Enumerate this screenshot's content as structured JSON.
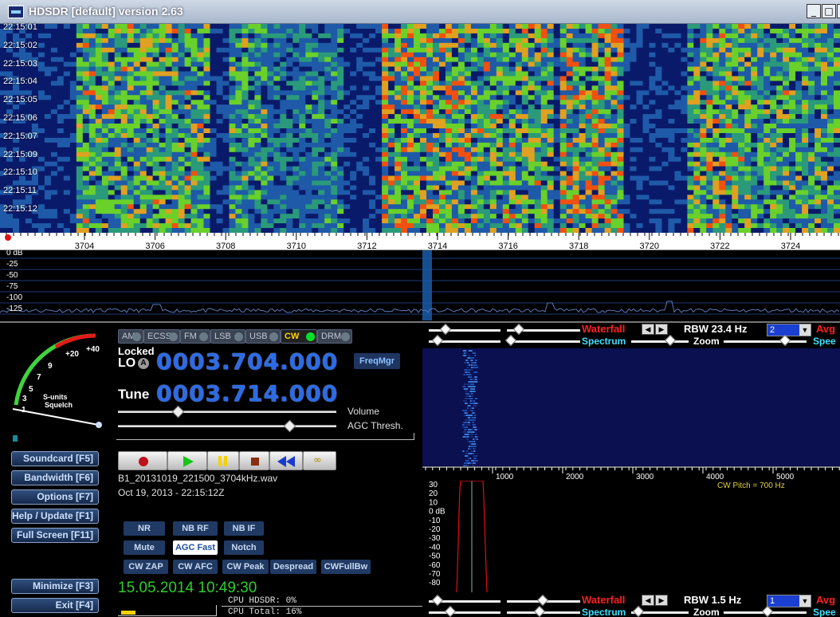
{
  "window": {
    "title": "HDSDR [default]  version 2.63",
    "minimize_glyph": "_",
    "maximize_glyph": "□",
    "close_glyph": "x"
  },
  "waterfall": {
    "timestamps": [
      "22:15:01",
      "22:15:02",
      "22:15:03",
      "22:15:04",
      "22:15:05",
      "22:15:06",
      "22:15:07",
      "22:15:09",
      "22:15:10",
      "22:15:11",
      "22:15:12"
    ]
  },
  "freq_scale": {
    "labels": [
      "3704",
      "3706",
      "3708",
      "3710",
      "3712",
      "3714",
      "3716",
      "3718",
      "3720",
      "3722",
      "3724"
    ]
  },
  "spectrum": {
    "db_labels": [
      "0 dB",
      "-25",
      "-50",
      "-75",
      "-100",
      "-125"
    ]
  },
  "smeter": {
    "scale_labels": [
      "1",
      "3",
      "5",
      "7",
      "9",
      "+20",
      "+40"
    ],
    "label1": "S-units",
    "label2": "Squelch"
  },
  "modes": [
    {
      "label": "AM",
      "active": false
    },
    {
      "label": "ECSS",
      "active": false
    },
    {
      "label": "FM",
      "active": false
    },
    {
      "label": "LSB",
      "active": false
    },
    {
      "label": "USB",
      "active": false
    },
    {
      "label": "CW",
      "active": true
    },
    {
      "label": "DRM",
      "active": false
    }
  ],
  "lo": {
    "locked_label": "Locked",
    "label": "LO",
    "badge": "A",
    "frequency": "0003.704.000"
  },
  "tune": {
    "label": "Tune",
    "frequency": "0003.714.000"
  },
  "freqmgr_label": "FreqMgr",
  "volume_label": "Volume",
  "agc_thresh_label": "AGC Thresh.",
  "side_buttons": [
    "Soundcard [F5]",
    "Bandwidth [F6]",
    "Options  [F7]",
    "Help / Update [F1]",
    "Full Screen [F11]",
    "Minimize [F3]",
    "Exit    [F4]"
  ],
  "recording": {
    "filename": "B1_20131019_221500_3704kHz.wav",
    "datetime": "Oct 19, 2013 - 22:15:12Z"
  },
  "feature_buttons": [
    {
      "label": "NR",
      "on": false
    },
    {
      "label": "NB RF",
      "on": false
    },
    {
      "label": "NB IF",
      "on": false
    },
    {
      "label": "Mute",
      "on": false
    },
    {
      "label": "AGC Fast",
      "on": true
    },
    {
      "label": "Notch",
      "on": false
    },
    {
      "label": "CW ZAP",
      "on": false
    },
    {
      "label": "CW AFC",
      "on": false
    },
    {
      "label": "CW Peak",
      "on": false
    },
    {
      "label": "Despread",
      "on": false
    },
    {
      "label": "CWFullBw",
      "on": false
    }
  ],
  "clock": "15.05.2014 10:49:30",
  "cpu": {
    "hdsdr": "CPU HDSDR: 0%",
    "total": "CPU Total: 16%"
  },
  "rf_panel": {
    "waterfall_label": "Waterfall",
    "spectrum_label": "Spectrum",
    "zoom_label": "Zoom",
    "rbw": "RBW 23.4 Hz",
    "avg_value": "2",
    "avg_label": "Avg",
    "speed_label": "Spee"
  },
  "af_panel": {
    "waterfall_label": "Waterfall",
    "spectrum_label": "Spectrum",
    "zoom_label": "Zoom",
    "rbw": "RBW  1.5 Hz",
    "avg_value": "1",
    "avg_label": "Avg",
    "speed_label": "Spee",
    "freq_labels": [
      "1000",
      "2000",
      "3000",
      "4000",
      "5000"
    ],
    "cw_pitch": "CW Pitch = 700 Hz",
    "db_labels": [
      "30",
      "20",
      "10",
      "0 dB",
      "-10",
      "-20",
      "-30",
      "-40",
      "-50",
      "-60",
      "-70",
      "-80"
    ]
  },
  "colors": {
    "freq_blue": "#2c6be5",
    "active_mode": "#ffd400",
    "led_on": "#00e22a",
    "waterfall_label_red": "#ff2020",
    "spectrum_label_cyan": "#40e0ff",
    "clock_green": "#2ecc2e"
  }
}
